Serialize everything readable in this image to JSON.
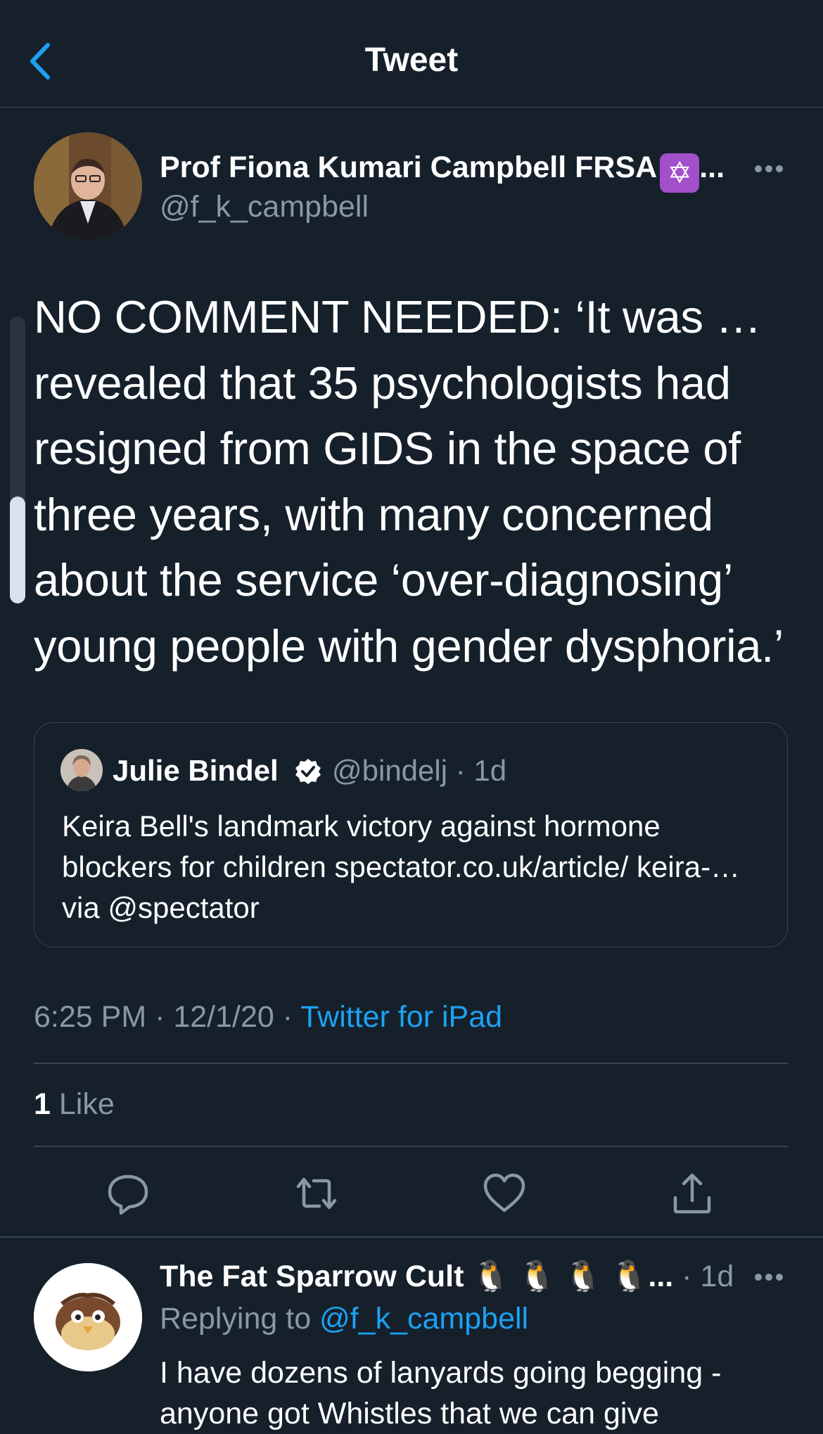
{
  "header": {
    "title": "Tweet",
    "back_icon": "chevron-left-icon"
  },
  "tweet": {
    "author_name": "Prof Fiona Kumari Campbell FRSA",
    "author_badge": "✡",
    "author_name_ellipsis": "...",
    "handle": "@f_k_campbell",
    "text": "NO COMMENT NEEDED: ‘It was …revealed that 35 psychologists had resigned from GIDS in the space of three years, with many concerned about the service ‘over-diagnosing’ young people with gender dysphoria.’",
    "quote": {
      "name": "Julie Bindel",
      "handle_time": "@bindelj · 1d",
      "text": "Keira Bell's landmark victory against hormone blockers for children spectator.co.uk/article/ keira-… via @spectator"
    },
    "timestamp": "6:25 PM · 12/1/20 · ",
    "source": "Twitter for iPad",
    "like_count": "1",
    "like_label": " Like"
  },
  "actions": {
    "reply_icon": "reply-icon",
    "retweet_icon": "retweet-icon",
    "like_icon": "heart-icon",
    "share_icon": "share-icon"
  },
  "reply": {
    "name": "The Fat Sparrow Cult",
    "emojis": "🐧 🐧 🐧 🐧",
    "ellipsis": "...",
    "time": " · 1d",
    "replying_prefix": "Replying to ",
    "replying_handle": "@f_k_campbell",
    "text": "I have dozens of lanyards going begging - anyone got Whistles that we can give"
  },
  "colors": {
    "background": "#15202b",
    "accent": "#1da1f2",
    "secondary_text": "#8899a6",
    "divider": "#38444d",
    "badge_purple": "#a24fc9"
  }
}
